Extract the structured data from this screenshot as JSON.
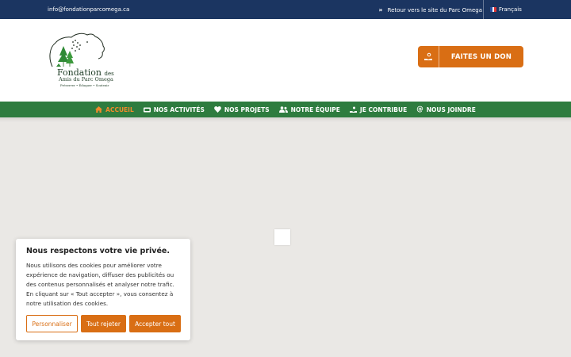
{
  "topbar": {
    "email": "info@fondationparcomega.ca",
    "external_link": "Retour vers le site du Parc Omega",
    "language": "Français"
  },
  "logo": {
    "line1": "Fondation",
    "line1_small": "des",
    "line2": "Amis du Parc Omega",
    "tagline": "Préserver • Éduquer • Soutenir"
  },
  "donate": {
    "label": "FAITES UN DON"
  },
  "nav": {
    "items": [
      {
        "label": "ACCUEIL",
        "icon": "home-icon"
      },
      {
        "label": "NOS ACTIVITÉS",
        "icon": "ticket-icon"
      },
      {
        "label": "NOS PROJETS",
        "icon": "heart-icon"
      },
      {
        "label": "NOTRE ÉQUIPE",
        "icon": "users-icon"
      },
      {
        "label": "JE CONTRIBUE",
        "icon": "hand-coin-icon"
      },
      {
        "label": "NOUS JOINDRE",
        "icon": "at-icon"
      }
    ]
  },
  "cookie": {
    "title": "Nous respectons votre vie privée.",
    "body": "Nous utilisons des cookies pour améliorer votre expérience de navigation, diffuser des publicités ou des contenus personnalisés et analyser notre trafic. En cliquant sur « Tout accepter », vous consentez à notre utilisation des cookies.",
    "customize": "Personnaliser",
    "reject": "Tout rejeter",
    "accept": "Accepter tout"
  },
  "colors": {
    "topbar": "#1b3561",
    "nav": "#2e7c3f",
    "accent": "#d96e14",
    "nav_active": "#f08a2b"
  }
}
